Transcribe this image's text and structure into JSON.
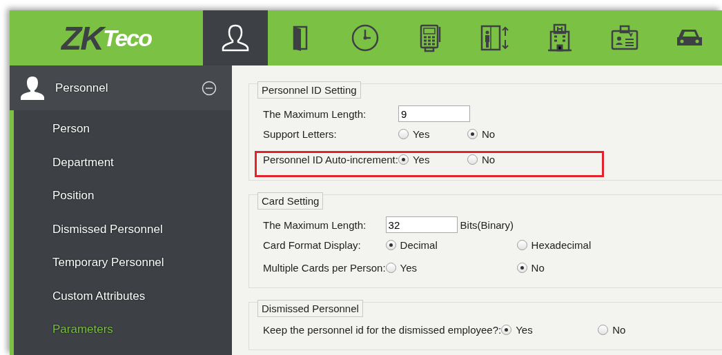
{
  "logo": {
    "dark": "ZK",
    "light": "Teco"
  },
  "modules": [
    {
      "kind": "person",
      "selected": true
    },
    {
      "kind": "door",
      "selected": false
    },
    {
      "kind": "clock",
      "selected": false
    },
    {
      "kind": "terminal",
      "selected": false
    },
    {
      "kind": "elevator",
      "selected": false
    },
    {
      "kind": "hotel",
      "selected": false
    },
    {
      "kind": "badge",
      "selected": false
    },
    {
      "kind": "car",
      "selected": false
    }
  ],
  "sidebar": {
    "title": "Personnel",
    "expanded": true,
    "items": [
      {
        "label": "Person",
        "selected": false
      },
      {
        "label": "Department",
        "selected": false
      },
      {
        "label": "Position",
        "selected": false
      },
      {
        "label": "Dismissed Personnel",
        "selected": false
      },
      {
        "label": "Temporary Personnel",
        "selected": false
      },
      {
        "label": "Custom Attributes",
        "selected": false
      },
      {
        "label": "Parameters",
        "selected": true
      }
    ]
  },
  "sections": [
    {
      "title": "Personnel ID Setting",
      "rows": [
        {
          "kind": "input",
          "label": "The Maximum Length:",
          "value": "9",
          "highlighted": false
        },
        {
          "kind": "radio",
          "label": "Support Letters:",
          "highlighted": false,
          "options": [
            {
              "label": "Yes",
              "selected": false
            },
            {
              "label": "No",
              "selected": true
            }
          ]
        },
        {
          "kind": "radio",
          "label": "Personnel ID Auto-increment:",
          "highlighted": true,
          "options": [
            {
              "label": "Yes",
              "selected": true
            },
            {
              "label": "No",
              "selected": false
            }
          ]
        }
      ]
    },
    {
      "title": "Card Setting",
      "rows": [
        {
          "kind": "input",
          "label": "The Maximum Length:",
          "value": "32",
          "suffix": "Bits(Binary)",
          "highlighted": false
        },
        {
          "kind": "radio",
          "label": "Card Format Display:",
          "highlighted": false,
          "options": [
            {
              "label": "Decimal",
              "selected": true
            },
            {
              "label": "Hexadecimal",
              "selected": false
            }
          ]
        },
        {
          "kind": "radio",
          "label": "Multiple Cards per Person:",
          "highlighted": false,
          "options": [
            {
              "label": "Yes",
              "selected": false
            },
            {
              "label": "No",
              "selected": true
            }
          ]
        }
      ]
    },
    {
      "title": "Dismissed Personnel",
      "rows": [
        {
          "kind": "radio",
          "label": "Keep the personnel id for the dismissed employee?:",
          "highlighted": false,
          "options": [
            {
              "label": "Yes",
              "selected": true
            },
            {
              "label": "No",
              "selected": false
            }
          ]
        }
      ]
    }
  ]
}
